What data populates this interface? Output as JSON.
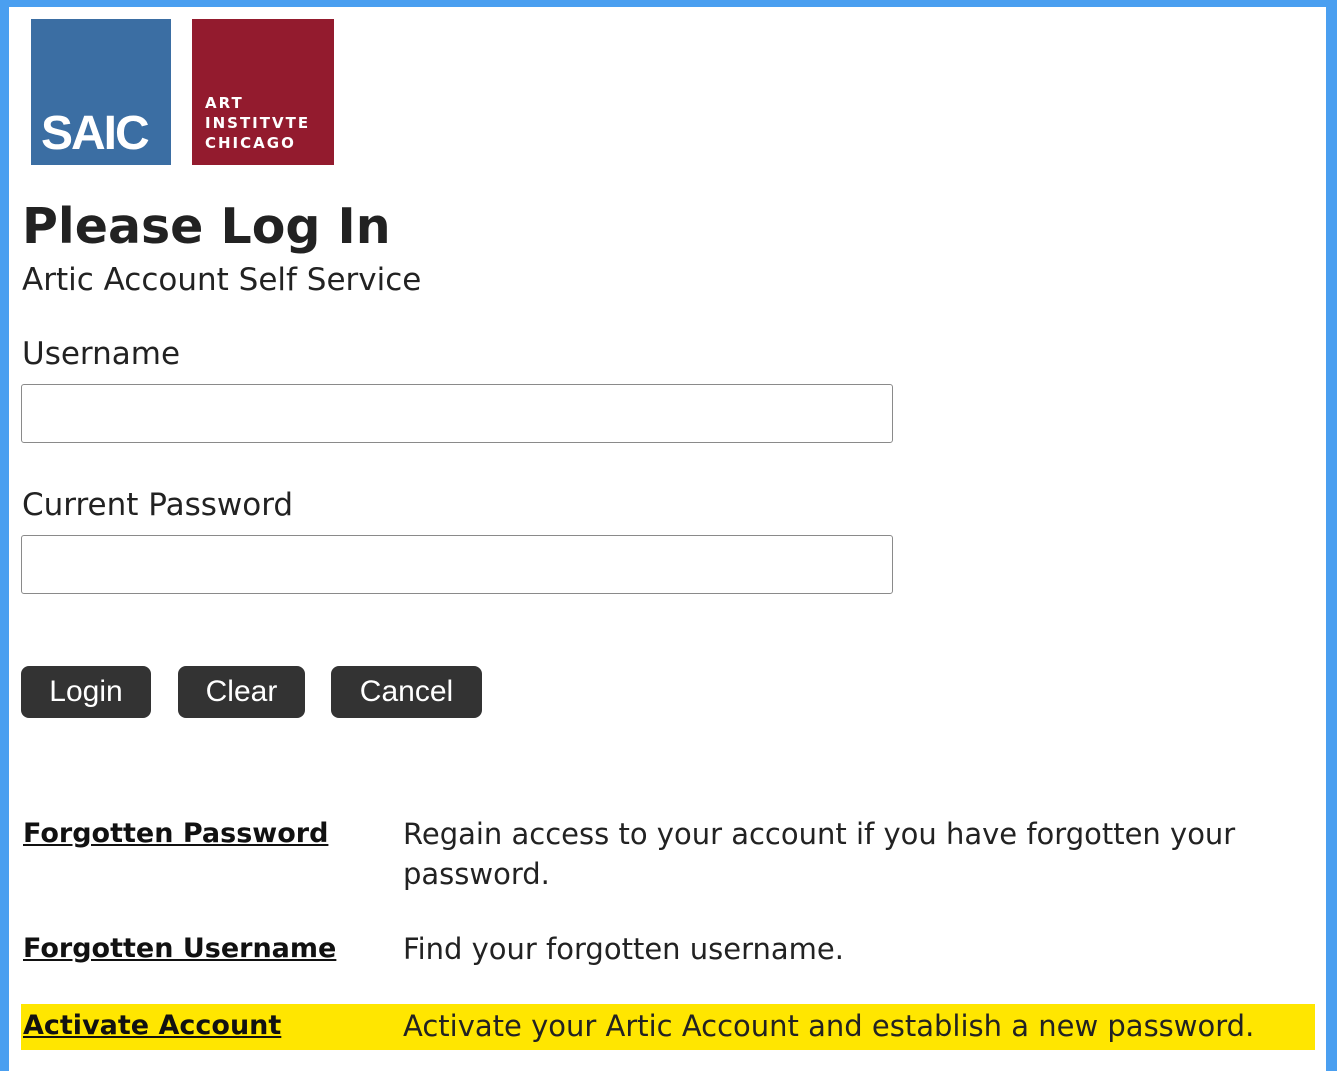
{
  "logos": {
    "saic": "SAIC",
    "aic_lines": [
      "ART",
      "INSTITVTE",
      "CHICAGO"
    ],
    "saic_color": "#3b6ea3",
    "aic_color": "#931b2e"
  },
  "header": {
    "title": "Please Log In",
    "subtitle": "Artic Account Self Service"
  },
  "form": {
    "username_label": "Username",
    "username_value": "",
    "password_label": "Current Password",
    "password_value": ""
  },
  "buttons": {
    "login": "Login",
    "clear": "Clear",
    "cancel": "Cancel"
  },
  "options": [
    {
      "link": "Forgotten Password",
      "description": "Regain access to your account if you have forgotten your password."
    },
    {
      "link": "Forgotten Username",
      "description": "Find your forgotten username."
    },
    {
      "link": "Activate Account",
      "description": "Activate your Artic Account and establish a new password.",
      "highlighted": true
    }
  ],
  "colors": {
    "frame": "#4a9ff0",
    "button_bg": "#333333",
    "highlight": "#ffe600"
  }
}
